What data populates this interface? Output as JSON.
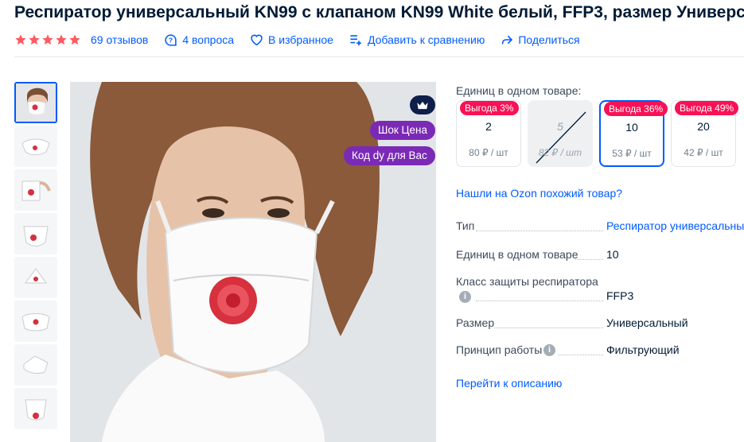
{
  "product": {
    "title": "Респиратор универсальный KN99 с клапаном KN99 White белый, FFP3, размер Универсальный",
    "rating_stars": 5,
    "reviews_label": "69 отзывов",
    "questions_label": "4 вопроса",
    "favorite_label": "В избранное",
    "compare_label": "Добавить к сравнению",
    "share_label": "Поделиться"
  },
  "badges": {
    "shock_price": "Шок Цена",
    "code_label": "Код ԁу для Вас"
  },
  "units": {
    "label": "Единиц в одном товаре:",
    "options": [
      {
        "save": "Выгода 3%",
        "qty": "2",
        "price": "80 ₽ / шт",
        "state": "normal"
      },
      {
        "save": "",
        "qty": "5",
        "price": "82 ₽ / шт",
        "state": "disabled"
      },
      {
        "save": "Выгода 36%",
        "qty": "10",
        "price": "53 ₽ / шт",
        "state": "selected"
      },
      {
        "save": "Выгода 49%",
        "qty": "20",
        "price": "42 ₽ / шт",
        "state": "normal"
      }
    ]
  },
  "similar_link": "Нашли на Ozon похожий товар?",
  "specs": [
    {
      "key": "Тип",
      "value": "Респиратор универсальный"
    },
    {
      "key": "Единиц в одном товаре",
      "value": "10"
    },
    {
      "key": "Класс защиты респиратора",
      "value": "FFP3"
    },
    {
      "key": "Размер",
      "value": "Универсальный"
    },
    {
      "key": "Принцип работы",
      "value": "Фильтрующий"
    }
  ],
  "goto_description": "Перейти к описанию",
  "colors": {
    "link": "#005bff",
    "star": "#ff5a5f",
    "save_badge": "#f91155",
    "promo_badge": "#7b2ab5",
    "crown_bg": "#0f1f4a"
  }
}
